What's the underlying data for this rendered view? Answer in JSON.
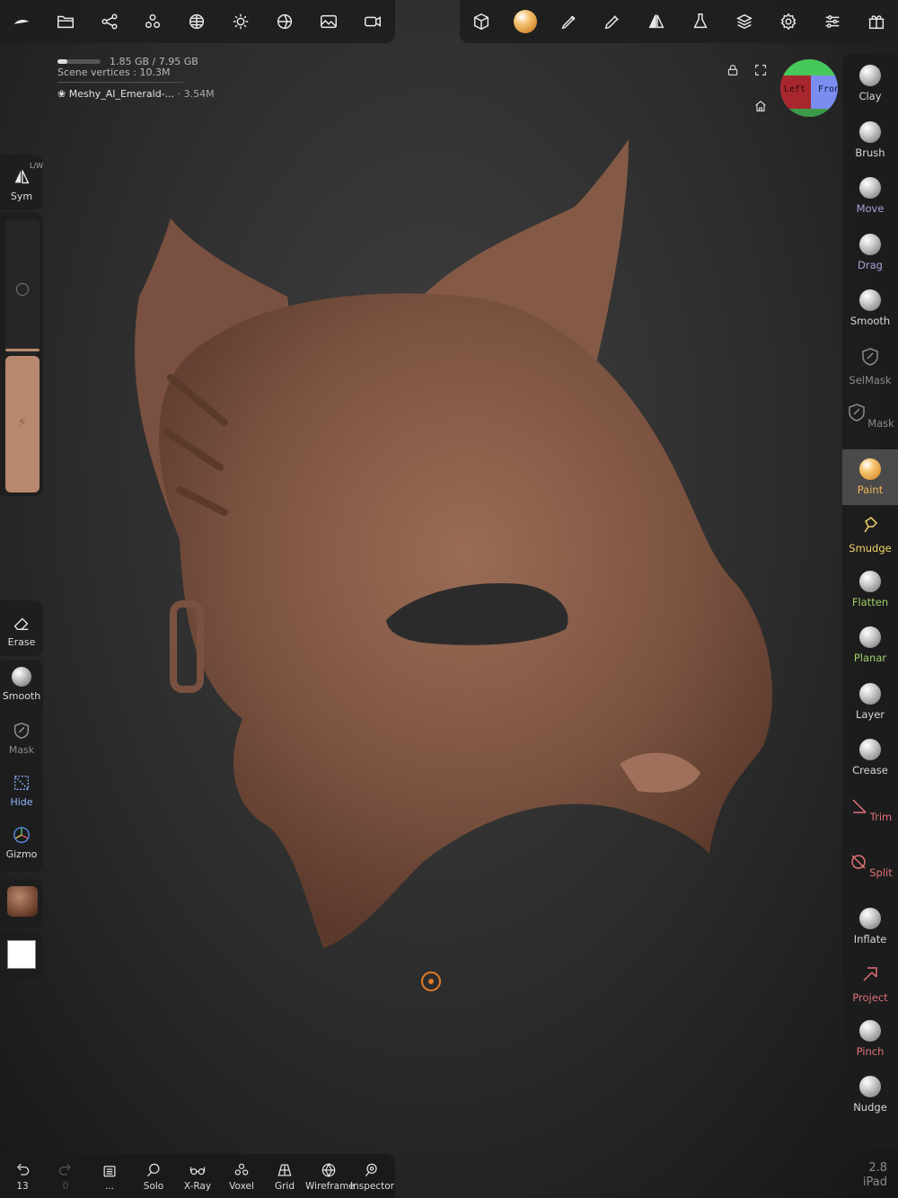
{
  "memory": {
    "text": "1.85 GB / 7.95 GB",
    "used_fraction": 0.23
  },
  "scene": {
    "vertices_text": "Scene vertices : 10.3M"
  },
  "mesh": {
    "name": "Meshy_AI_Emerald-...",
    "count": "· 3.54M"
  },
  "top_left_icons": [
    "logo-icon",
    "folder-icon",
    "share-icon",
    "scene-tree-icon",
    "grid-sphere-icon",
    "light-icon",
    "material-icon",
    "image-icon",
    "camera-icon"
  ],
  "top_right_icons": [
    "cube-icon",
    "material-ball-icon",
    "pencil-icon",
    "brush-icon",
    "symmetry-icon",
    "flask-icon",
    "layers-icon",
    "gear-icon",
    "sliders-icon",
    "gift-icon"
  ],
  "view_cube": {
    "left_label": "Left",
    "front_label": "Front"
  },
  "left_rail": {
    "sym": {
      "label": "Sym",
      "sub": "L/W"
    },
    "erase": "Erase",
    "smooth": "Smooth",
    "mask": "Mask",
    "hide": "Hide",
    "gizmo": "Gizmo",
    "color_swatch": "#ffffff"
  },
  "tools": [
    {
      "label": "Clay",
      "color": "#d8d8d8",
      "kind": "ball"
    },
    {
      "label": "Brush",
      "color": "#d8d8d8",
      "kind": "ball"
    },
    {
      "label": "Move",
      "color": "#a9a2d6",
      "kind": "ball"
    },
    {
      "label": "Drag",
      "color": "#a9a2d6",
      "kind": "ball"
    },
    {
      "label": "Smooth",
      "color": "#d8d8d8",
      "kind": "ball"
    },
    {
      "label": "SelMask",
      "color": "#8c8c8c",
      "kind": "shield"
    },
    {
      "label": "Mask",
      "color": "#8c8c8c",
      "kind": "shield"
    },
    {
      "label": "Paint",
      "color": "#f0b45a",
      "kind": "paint",
      "active": true
    },
    {
      "label": "Smudge",
      "color": "#f2d36a",
      "kind": "smudge"
    },
    {
      "label": "Flatten",
      "color": "#9fcf6a",
      "kind": "ball"
    },
    {
      "label": "Planar",
      "color": "#9fcf6a",
      "kind": "ball"
    },
    {
      "label": "Layer",
      "color": "#d8d8d8",
      "kind": "ball"
    },
    {
      "label": "Crease",
      "color": "#d8d8d8",
      "kind": "ball"
    },
    {
      "label": "Trim",
      "color": "#e0727a",
      "kind": "trim"
    },
    {
      "label": "Split",
      "color": "#e0727a",
      "kind": "split"
    },
    {
      "label": "Inflate",
      "color": "#d8d8d8",
      "kind": "ball"
    },
    {
      "label": "Project",
      "color": "#e0727a",
      "kind": "project"
    },
    {
      "label": "Pinch",
      "color": "#e0727a",
      "kind": "ball"
    },
    {
      "label": "Nudge",
      "color": "#d8d8d8",
      "kind": "ball"
    }
  ],
  "bottom": {
    "undo_count": "13",
    "redo_count": "0",
    "solo": "Solo",
    "xray": "X-Ray",
    "voxel": "Voxel",
    "grid": "Grid",
    "wireframe": "Wireframe",
    "inspector": "Inspector",
    "more": "..."
  },
  "version": {
    "number": "2.8",
    "device": "iPad"
  },
  "colors": {
    "clay": "#7a5240",
    "accent": "#e07b28",
    "paint_slider": "#b8896e"
  }
}
